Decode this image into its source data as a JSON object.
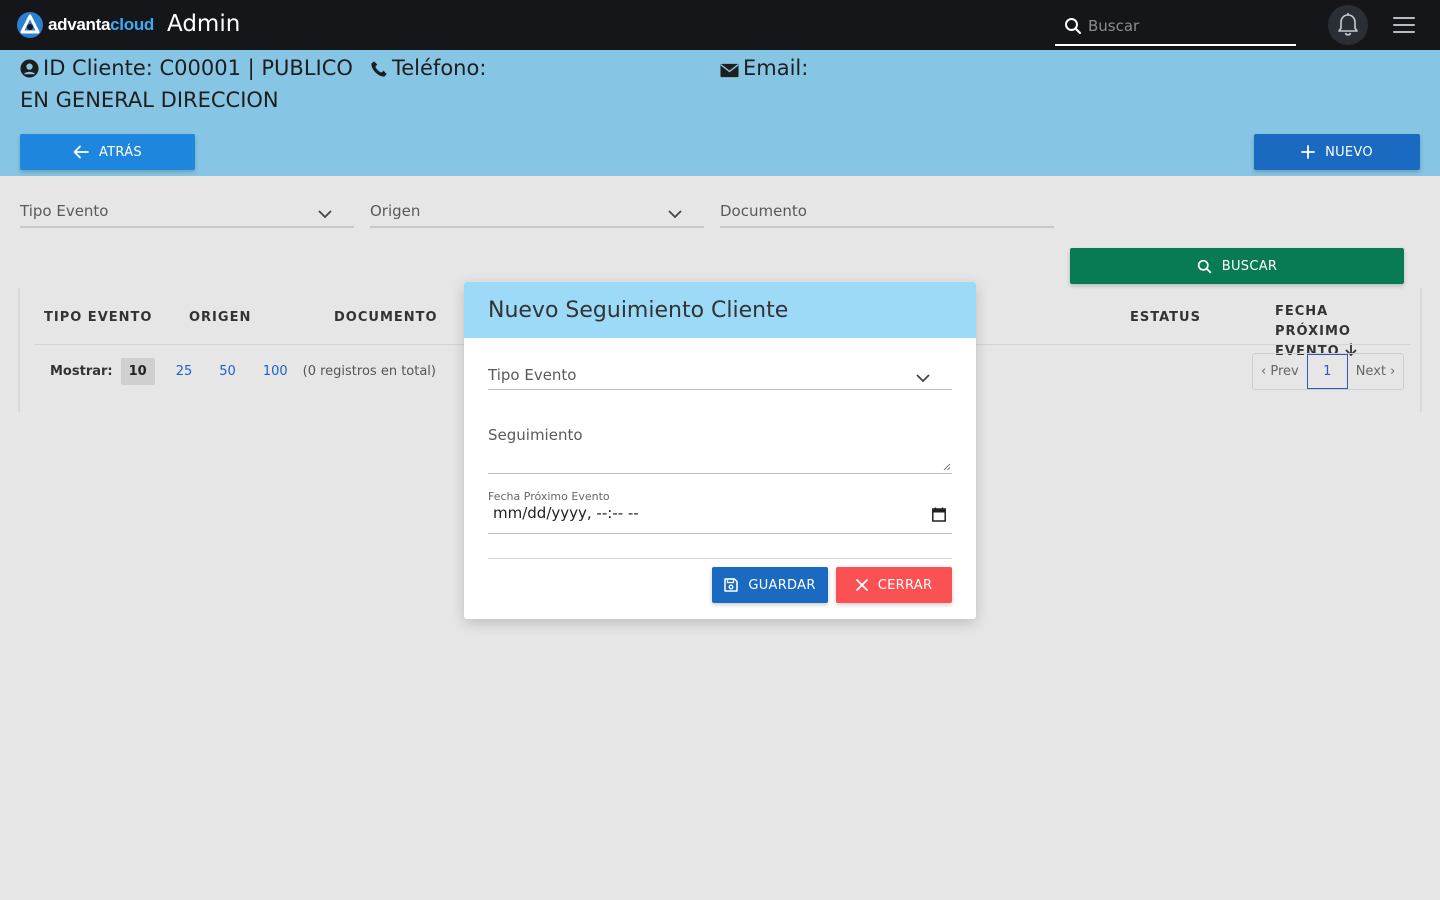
{
  "app": {
    "logo_part1": "advanta",
    "logo_part2": "cloud",
    "title": "Admin"
  },
  "search": {
    "placeholder": "Buscar"
  },
  "client": {
    "id_line": "ID Cliente: C00001 | PUBLICO EN GENERAL DIRECCION",
    "phone_label": "Teléfono:",
    "email_label": "Email:"
  },
  "buttons": {
    "back": "ATRÁS",
    "new": "NUEVO",
    "search": "BUSCAR"
  },
  "filters": {
    "tipo_evento": "Tipo Evento",
    "origen": "Origen",
    "documento": "Documento"
  },
  "table": {
    "headers": [
      "TIPO EVENTO",
      "ORIGEN",
      "DOCUMENTO",
      "ESTATUS",
      "FECHA PRÓXIMO EVENTO"
    ],
    "show_label": "Mostrar:",
    "page_sizes": [
      "10",
      "25",
      "50",
      "100"
    ],
    "selected_page_size": "10",
    "total_text": "(0 registros en total)",
    "prev": "‹ Prev",
    "current_page": "1",
    "next": "Next ›"
  },
  "modal": {
    "title": "Nuevo Seguimiento Cliente",
    "tipo_evento_label": "Tipo Evento",
    "seguimiento_label": "Seguimiento",
    "fecha_label": "Fecha Próximo Evento",
    "fecha_value": "mm/dd/yyyy, --:-- --",
    "save": "GUARDAR",
    "close": "CERRAR"
  },
  "colors": {
    "topbar": "#141619",
    "header_band": "#86c5e3",
    "primary": "#1b6ac2",
    "back_button": "#1f86dd",
    "search_button": "#097b54",
    "close_button": "#fb5152",
    "modal_header": "#9cdaf7"
  }
}
